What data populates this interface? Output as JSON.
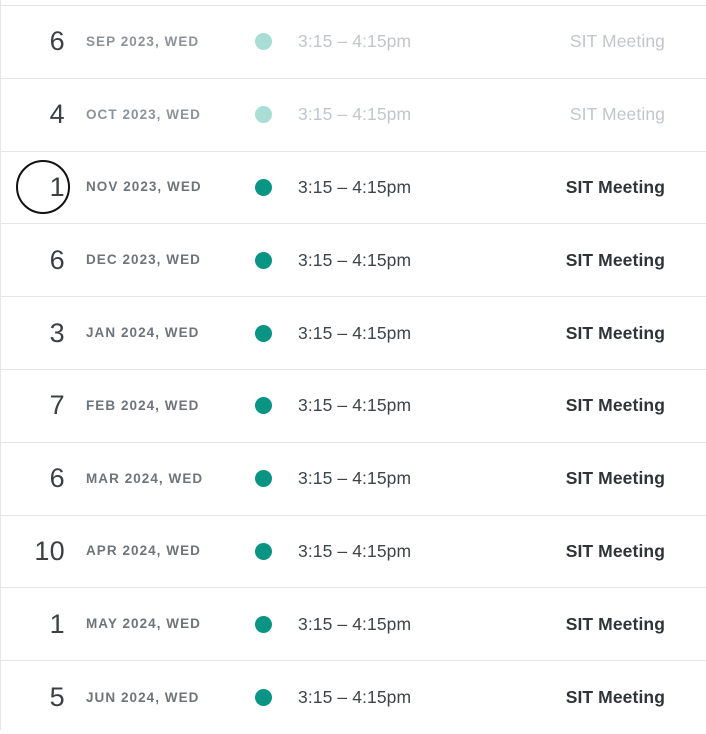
{
  "colors": {
    "dot_active": "#0a9484",
    "dot_faded": "#a9ded6",
    "separator": "#e4e6e8",
    "text_primary": "#2f3437",
    "text_secondary": "#6f7479",
    "text_faded": "#c2c6ca",
    "selected_ring": "#111111"
  },
  "schedule": {
    "name": "recurring-meeting-occurrences",
    "rows": [
      {
        "day": "6",
        "date_label": "SEP 2023, WED",
        "time": "3:15 – 4:15pm",
        "title": "SIT Meeting",
        "state": "past",
        "selected": false
      },
      {
        "day": "4",
        "date_label": "OCT 2023, WED",
        "time": "3:15 – 4:15pm",
        "title": "SIT Meeting",
        "state": "past",
        "selected": false
      },
      {
        "day": "1",
        "date_label": "NOV 2023, WED",
        "time": "3:15 – 4:15pm",
        "title": "SIT Meeting",
        "state": "current",
        "selected": true
      },
      {
        "day": "6",
        "date_label": "DEC 2023, WED",
        "time": "3:15 – 4:15pm",
        "title": "SIT Meeting",
        "state": "upcoming",
        "selected": false
      },
      {
        "day": "3",
        "date_label": "JAN 2024, WED",
        "time": "3:15 – 4:15pm",
        "title": "SIT Meeting",
        "state": "upcoming",
        "selected": false
      },
      {
        "day": "7",
        "date_label": "FEB 2024, WED",
        "time": "3:15 – 4:15pm",
        "title": "SIT Meeting",
        "state": "upcoming",
        "selected": false
      },
      {
        "day": "6",
        "date_label": "MAR 2024, WED",
        "time": "3:15 – 4:15pm",
        "title": "SIT Meeting",
        "state": "upcoming",
        "selected": false
      },
      {
        "day": "10",
        "date_label": "APR 2024, WED",
        "time": "3:15 – 4:15pm",
        "title": "SIT Meeting",
        "state": "upcoming",
        "selected": false
      },
      {
        "day": "1",
        "date_label": "MAY 2024, WED",
        "time": "3:15 – 4:15pm",
        "title": "SIT Meeting",
        "state": "upcoming",
        "selected": false
      },
      {
        "day": "5",
        "date_label": "JUN 2024, WED",
        "time": "3:15 – 4:15pm",
        "title": "SIT Meeting",
        "state": "upcoming",
        "selected": false
      }
    ]
  }
}
